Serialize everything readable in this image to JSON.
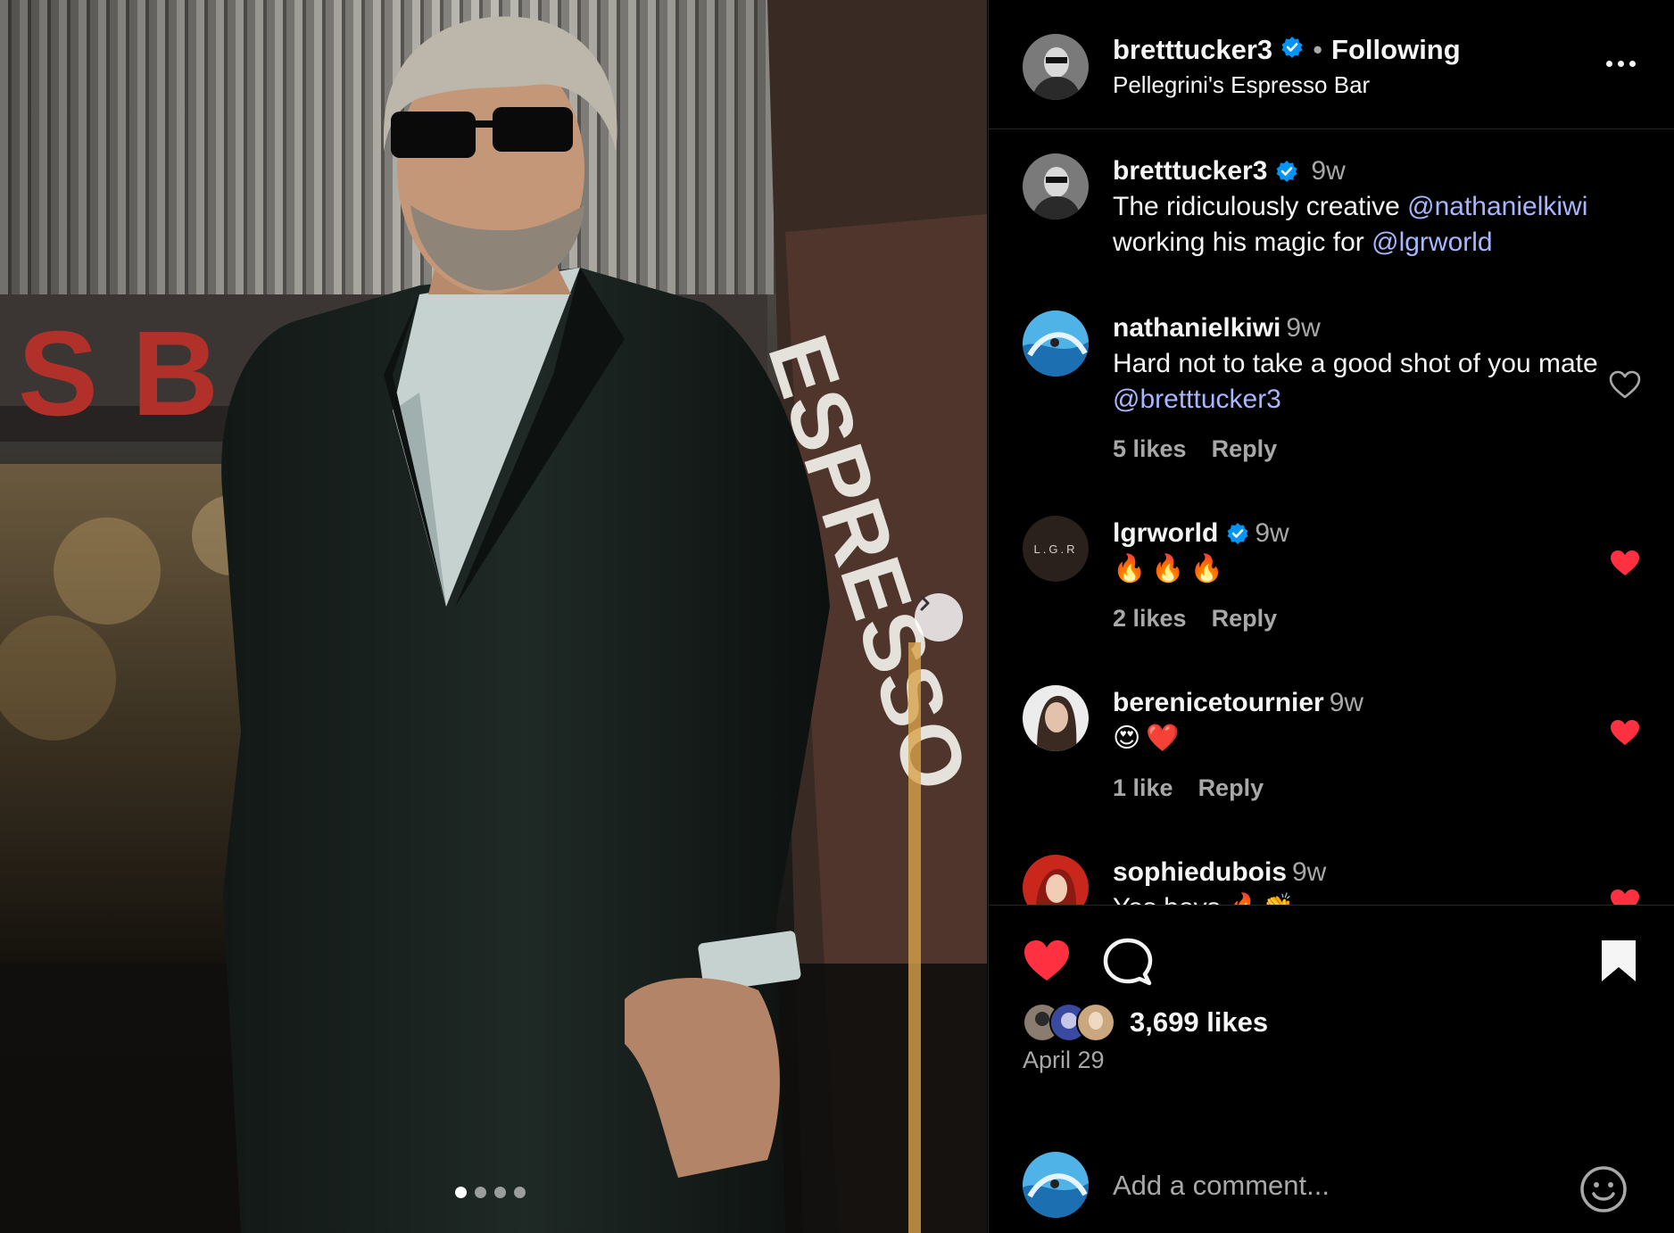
{
  "header": {
    "username": "bretttucker3",
    "separator": "•",
    "follow_status": "Following",
    "location": "Pellegrini's Espresso Bar"
  },
  "photo": {
    "storefront_letters": "S B A",
    "storefront_sign": "ESPRESSO",
    "carousel_dots": 4,
    "active_dot": 0
  },
  "caption": {
    "username": "bretttucker3",
    "time": "9w",
    "text_pre": "The ridiculously creative ",
    "mention1": "@nathanielkiwi",
    "text_mid": " working his magic for ",
    "mention2": "@lgrworld"
  },
  "comments": [
    {
      "username": "nathanielkiwi",
      "time": "9w",
      "text": "Hard not to take a good shot of you mate ",
      "mention": "@bretttucker3",
      "likes": "5 likes",
      "reply": "Reply",
      "liked": false
    },
    {
      "username": "lgrworld",
      "verified": true,
      "time": "9w",
      "text": "🔥🔥🔥",
      "avatar_text": "L.G.R",
      "likes": "2 likes",
      "reply": "Reply",
      "liked": true
    },
    {
      "username": "berenicetournier",
      "time": "9w",
      "text": "😍❤️",
      "likes": "1 like",
      "reply": "Reply",
      "liked": true
    },
    {
      "username": "sophiedubois",
      "time": "9w",
      "text": "Yes boys 🔥👏",
      "liked": true
    }
  ],
  "actions": {
    "likes_count": "3,699 likes",
    "date": "April 29"
  },
  "add_comment": {
    "placeholder": "Add a comment..."
  },
  "colors": {
    "background": "#000000",
    "text": "#f5f5f5",
    "muted": "#a8a8a8",
    "mention": "#a7b6ff",
    "verified": "#0095f6",
    "like_red": "#ff3040",
    "divider": "#262626"
  },
  "icons": {
    "verified": "verified-badge-icon",
    "more": "more-options-icon",
    "heart": "heart-icon",
    "comment": "comment-icon",
    "bookmark": "bookmark-icon",
    "emoji": "emoji-icon",
    "carousel_next": "chevron-right-icon"
  }
}
